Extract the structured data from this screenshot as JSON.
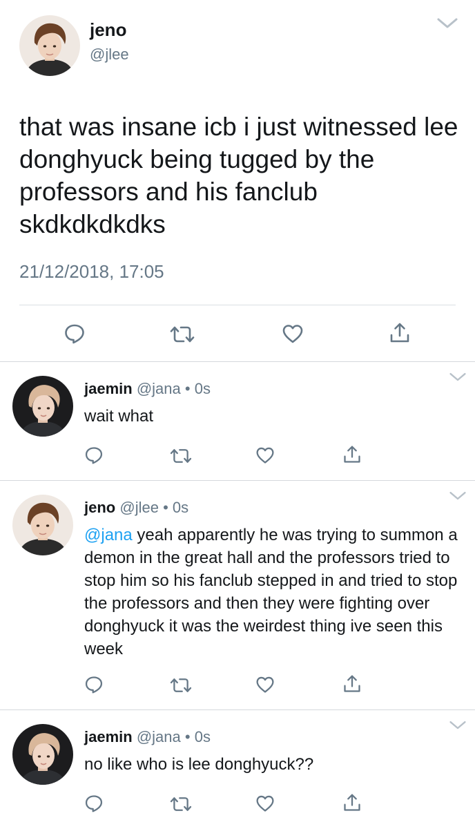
{
  "main_tweet": {
    "display_name": "jeno",
    "handle": "@jlee",
    "text": "that was insane icb i just witnessed lee donghyuck being tugged by the professors and his fanclub skdkdkdkdks",
    "timestamp": "21/12/2018, 17:05",
    "actions": [
      "reply-icon",
      "retweet-icon",
      "like-icon",
      "share-icon"
    ]
  },
  "replies": [
    {
      "display_name": "jaemin",
      "handle": "@jana",
      "time": "0s",
      "mention": "",
      "text": "wait what",
      "avatar_style": "light-hair"
    },
    {
      "display_name": "jeno",
      "handle": "@jlee",
      "time": "0s",
      "mention": "@jana",
      "text": " yeah apparently he was trying to summon a demon in the great hall and the professors tried to stop him so his fanclub stepped in and tried to stop the professors and then they were fighting over donghyuck it was the weirdest thing ive seen this week",
      "avatar_style": "brown-hair"
    },
    {
      "display_name": "jaemin",
      "handle": "@jana",
      "time": "0s",
      "mention": "",
      "text": "no like who is lee donghyuck??",
      "avatar_style": "light-hair"
    }
  ],
  "meta_separator": "•",
  "colors": {
    "text": "#14171a",
    "secondary": "#657786",
    "mention": "#1da1f2",
    "divider": "#d4d8dc"
  }
}
